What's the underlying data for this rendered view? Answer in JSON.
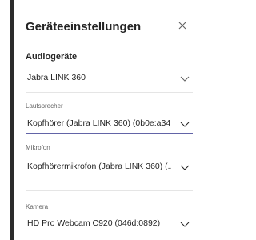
{
  "dialog": {
    "title": "Geräteeinstellungen",
    "close_icon": "close-icon"
  },
  "audio": {
    "heading": "Audiogeräte",
    "device_value": "Jabra LINK 360"
  },
  "speaker": {
    "label": "Lautsprecher",
    "value": "Kopfhörer (Jabra LINK 360) (0b0e:a34..."
  },
  "microphone": {
    "label": "Mikrofon",
    "value": "Kopfhörermikrofon (Jabra LINK 360) (..."
  },
  "camera": {
    "label": "Kamera",
    "value": "HD Pro Webcam C920 (046d:0892)"
  },
  "colors": {
    "focus_underline": "#6264a7",
    "panel_border": "#2b2b2b",
    "text": "#242424",
    "muted_text": "#616161"
  }
}
